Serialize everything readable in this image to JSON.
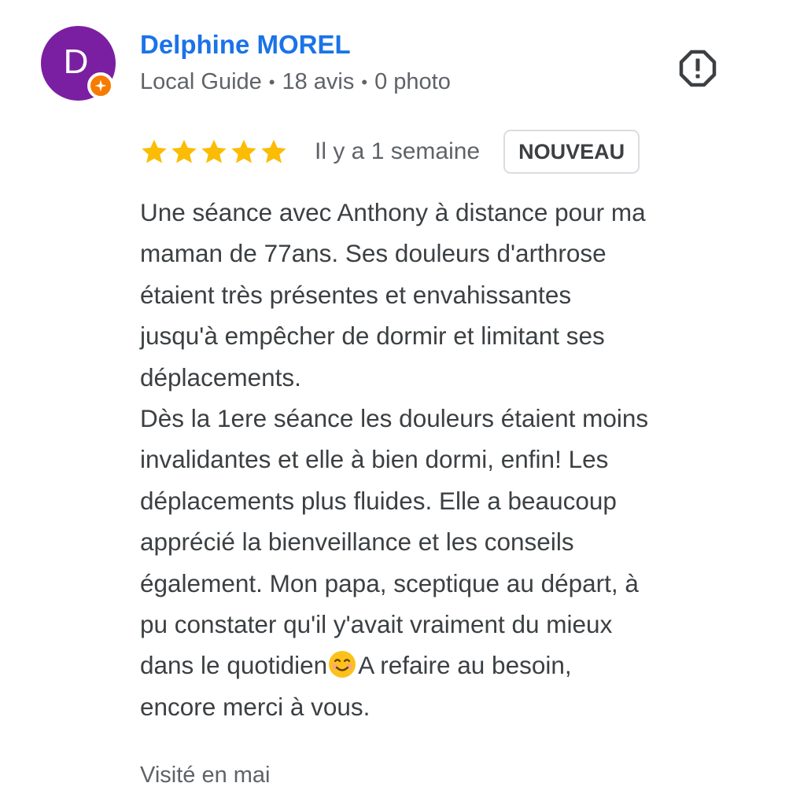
{
  "reviewer": {
    "initial": "D",
    "name": "Delphine MOREL",
    "role": "Local Guide",
    "reviews_count": "18 avis",
    "photos_count": "0 photo",
    "separator": "•",
    "avatar_color": "#7b1fa2",
    "badge_color": "#f57c00",
    "badge_icon": "local-guide-star-icon"
  },
  "review": {
    "rating": 5,
    "rating_max": 5,
    "star_color": "#fbbc04",
    "time": "Il y a 1 semaine",
    "new_badge": "NOUVEAU",
    "lines": [
      "Une séance avec Anthony à distance pour ma",
      "maman de 77ans. Ses douleurs d'arthrose",
      "étaient très présentes et envahissantes",
      "jusqu'à empêcher de dormir et limitant ses",
      "déplacements.",
      "Dès la 1ere séance les douleurs étaient moins",
      "invalidantes et elle à bien dormi, enfin! Les",
      "déplacements plus fluides. Elle a beaucoup",
      "apprécié la bienveillance et les conseils",
      "également. Mon papa, sceptique au départ, à",
      "pu constater qu'il y'avait vraiment du mieux",
      "dans le quotidien",
      "encore merci à vous."
    ],
    "line12_after_emoji": "A refaire au besoin,",
    "emoji_icon": "smiling-face-emoji-icon",
    "visited": "Visité en mai"
  },
  "actions": {
    "report_icon": "report-flag-icon"
  },
  "colors": {
    "name_link": "#1a73e8",
    "secondary_text": "#5f6368",
    "body_text": "#3c4043"
  }
}
